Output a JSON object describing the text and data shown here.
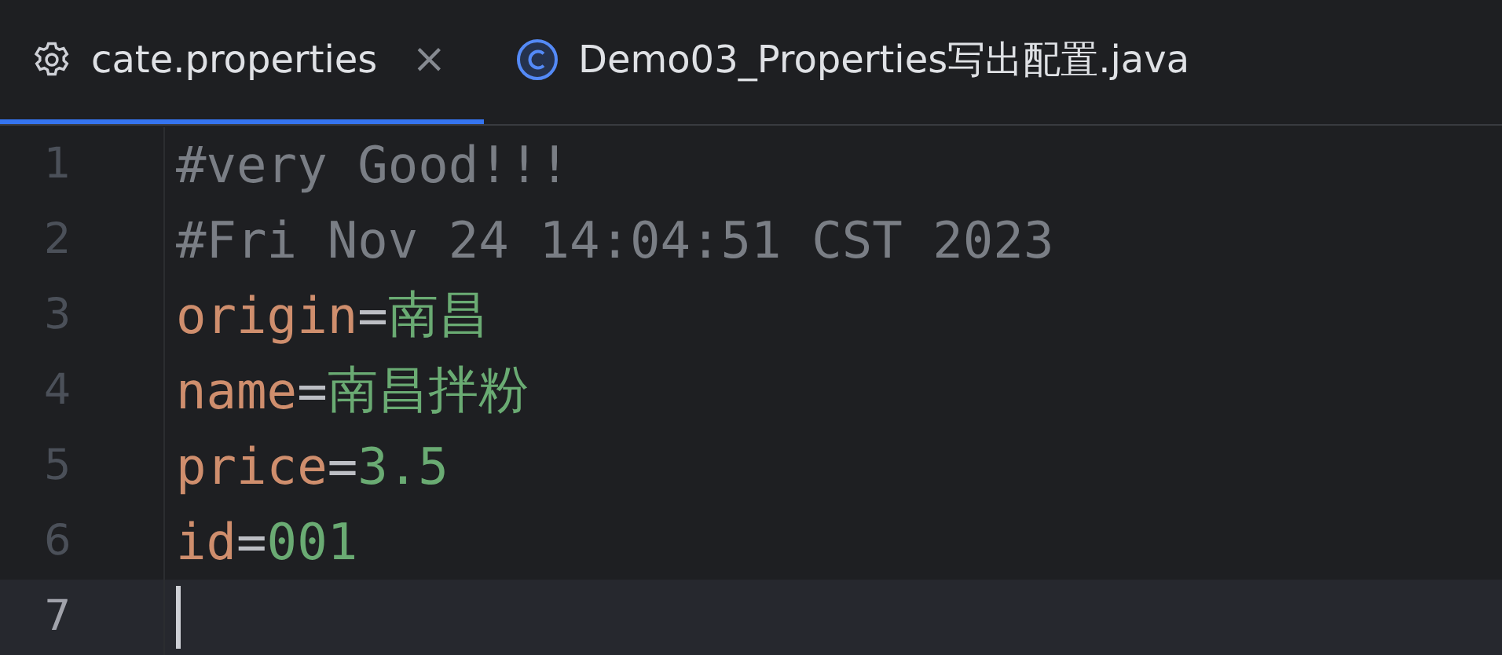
{
  "tabs": [
    {
      "label": "cate.properties",
      "kind": "settings",
      "selected": true,
      "close": "×"
    },
    {
      "label": "Demo03_Properties写出配置.java",
      "kind": "class",
      "selected": false
    }
  ],
  "editor": {
    "lines": [
      {
        "number": "1",
        "kind": "comment",
        "text": "#very Good!!!",
        "current": false
      },
      {
        "number": "2",
        "kind": "comment",
        "text": "#Fri Nov 24 14:04:51 CST 2023",
        "current": false
      },
      {
        "number": "3",
        "kind": "property",
        "key": "origin",
        "separator": "=",
        "value": "南昌",
        "current": false
      },
      {
        "number": "4",
        "kind": "property",
        "key": "name",
        "separator": "=",
        "value": "南昌拌粉",
        "current": false
      },
      {
        "number": "5",
        "kind": "property",
        "key": "price",
        "separator": "=",
        "value": "3.5",
        "current": false
      },
      {
        "number": "6",
        "kind": "property",
        "key": "id",
        "separator": "=",
        "value": "001",
        "current": false
      },
      {
        "number": "7",
        "kind": "empty",
        "current": true
      }
    ]
  }
}
